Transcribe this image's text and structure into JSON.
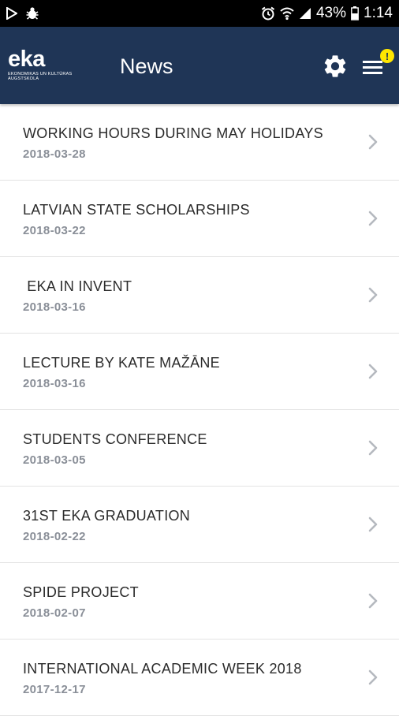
{
  "status_bar": {
    "battery_percent": "43%",
    "time": "1:14",
    "icons": [
      "play-store-icon",
      "bug-icon",
      "alarm-icon",
      "wifi-icon",
      "signal-icon",
      "battery-icon"
    ]
  },
  "header": {
    "logo_text": "eka",
    "logo_subtext": "EKONOMIKAS UN KULTŪRAS AUGSTSKOLA",
    "title": "News",
    "notification_badge": "!",
    "colors": {
      "background": "#1f3556",
      "badge": "#ffe600"
    },
    "icons": [
      "gear-icon",
      "menu-icon"
    ]
  },
  "news": [
    {
      "title": "WORKING HOURS DURING MAY HOLIDAYS",
      "date": "2018-03-28"
    },
    {
      "title": "LATVIAN STATE SCHOLARSHIPS",
      "date": "2018-03-22"
    },
    {
      "title": " EKA IN INVENT",
      "date": "2018-03-16"
    },
    {
      "title": "LECTURE BY KATE MAŽĀNE",
      "date": "2018-03-16"
    },
    {
      "title": "STUDENTS CONFERENCE",
      "date": "2018-03-05"
    },
    {
      "title": "31ST EKA GRADUATION",
      "date": "2018-02-22"
    },
    {
      "title": "SPIDE PROJECT",
      "date": "2018-02-07"
    },
    {
      "title": "INTERNATIONAL ACADEMIC WEEK 2018",
      "date": "2017-12-17"
    }
  ]
}
